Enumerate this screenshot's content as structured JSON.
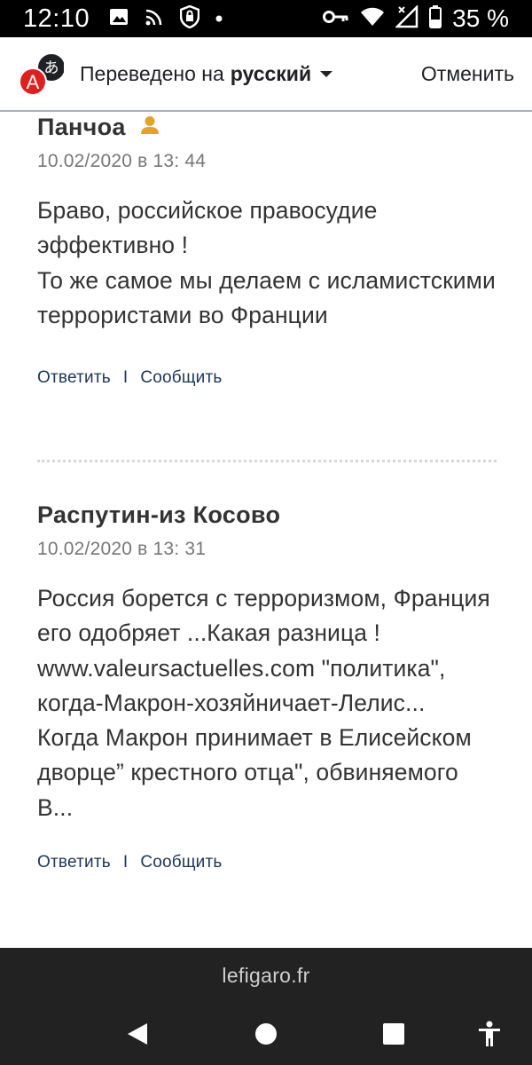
{
  "status_bar": {
    "time": "12:10",
    "battery_percent": "35 %",
    "icons": [
      "gallery-icon",
      "cast-icon",
      "vpn-shield-icon",
      "notification-dot-icon",
      "key-icon",
      "wifi-icon",
      "signal-icon",
      "battery-icon"
    ]
  },
  "translate_bar": {
    "prefix": "Переведено на",
    "language": "русский",
    "cancel_label": "Отменить",
    "logo_letter": "A",
    "logo_glyph": "あ"
  },
  "comments": [
    {
      "author": "Панчоа",
      "has_user_icon": true,
      "date": "10.02/2020 в 13: 44",
      "body": "Браво, российское правосудие эффективно !\nТо же самое мы делаем с исламистскими террористами во Франции",
      "reply_label": "Ответить",
      "separator": "I",
      "report_label": "Сообщить"
    },
    {
      "author": "Распутин-из Косово",
      "has_user_icon": false,
      "date": "10.02/2020 в 13: 31",
      "body": "Россия борется с терроризмом, Франция его одобряет ...Какая разница ! www.valeursactuelles.com \"политика\", когда-Макрон-хозяйничает-Лелис...\nКогда Макрон принимает в Елисейском дворце” крестного отца\", обвиняемого В...",
      "reply_label": "Ответить",
      "separator": "I",
      "report_label": "Сообщить"
    }
  ],
  "footer": {
    "site": "lefigaro.fr"
  },
  "colors": {
    "user_icon": "#e0a526",
    "link": "#1d3557",
    "logo_red": "#e0201f"
  }
}
